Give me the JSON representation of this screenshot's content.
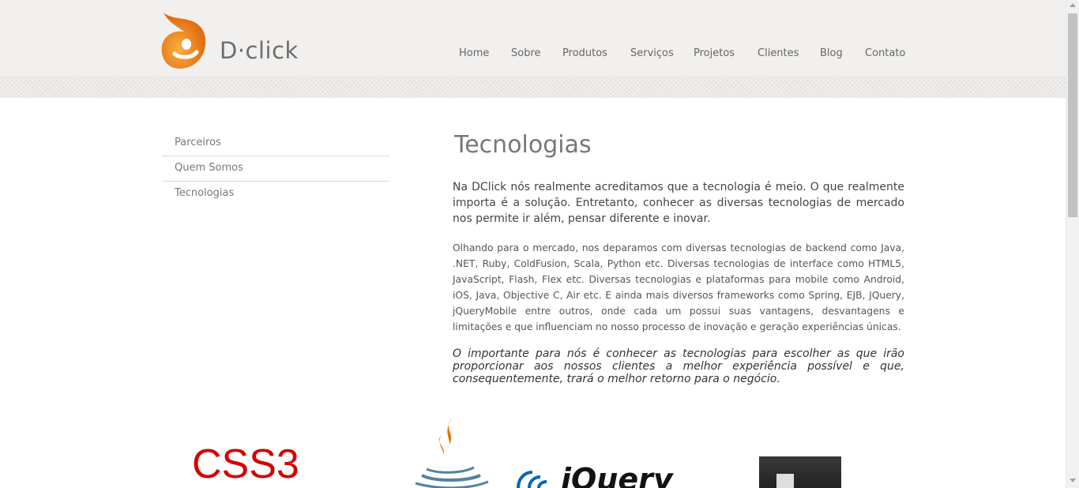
{
  "brand": {
    "name": "D·click",
    "accent": "#f08a1c"
  },
  "nav": {
    "items": [
      "Home",
      "Sobre",
      "Produtos",
      "Serviços",
      "Projetos",
      "Clientes",
      "Blog",
      "Contato"
    ]
  },
  "sidebar": {
    "items": [
      "Parceiros",
      "Quem Somos",
      "Tecnologias"
    ]
  },
  "main": {
    "title": "Tecnologias",
    "intro": "Na DClick nós realmente acreditamos que a tecnologia é meio. O que realmente importa é a solução. Entretanto, conhecer as diversas tecnologias de mercado nos permite ir além, pensar diferente e inovar.",
    "body": "Olhando para o mercado, nos deparamos com diversas tecnologias de backend como Java, .NET, Ruby, ColdFusion, Scala, Python etc. Diversas tecnologias de interface como HTML5, JavaScript, Flash, Flex etc. Diversas tecnologias e plataformas para mobile como Android, iOS, Java, Objective C, Air etc. E ainda mais diversos frameworks como Spring, EJB, JQuery, jQueryMobile entre outros, onde cada um possui suas vantagens, desvantagens e limitações e que influenciam no nosso processo de inovação e geração experiências únicas.",
    "closing": "O importante para nós é conhecer as tecnologias para escolher as que irão proporcionar aos nossos clientes a melhor experiência possível e que, consequentemente, trará o melhor retorno para o negócio."
  },
  "tech_logos": {
    "css3": "CSS3",
    "jquery": "jQuery",
    "java": "java-logo",
    "html5": "html5-logo"
  }
}
